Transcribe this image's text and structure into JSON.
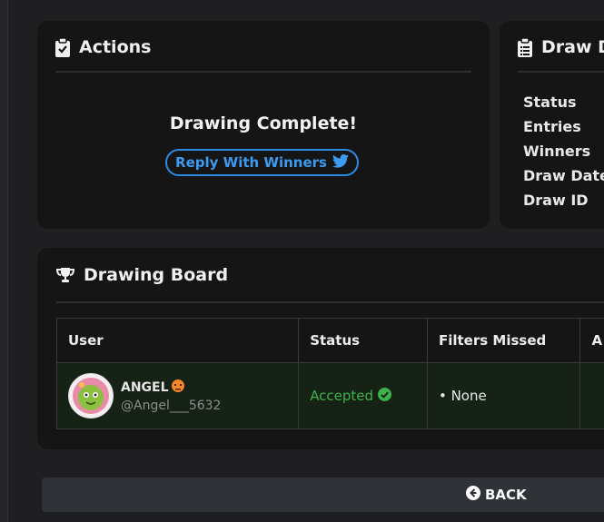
{
  "actions": {
    "title": "Actions",
    "complete_text": "Drawing Complete!",
    "reply_button": "Reply With Winners"
  },
  "draw_details": {
    "title": "Draw De",
    "labels": [
      "Status",
      "Entries",
      "Winners",
      "Draw Date",
      "Draw ID"
    ]
  },
  "board": {
    "title": "Drawing Board",
    "columns": [
      "User",
      "Status",
      "Filters Missed",
      "A"
    ],
    "rows": [
      {
        "name": "ANGEL",
        "handle": "@Angel___5632",
        "status": "Accepted",
        "filters_missed": "• None"
      }
    ]
  },
  "back_button": "BACK",
  "colors": {
    "accent_blue": "#2a8be0",
    "success_green": "#3db14a",
    "card_bg": "#151516",
    "page_bg": "#1f1f21"
  },
  "icons": {
    "actions": "clipboard-check-icon",
    "details": "clipboard-list-icon",
    "board": "trophy-icon",
    "reply": "twitter-icon",
    "status": "check-circle-icon",
    "back": "arrow-circle-left-icon"
  }
}
